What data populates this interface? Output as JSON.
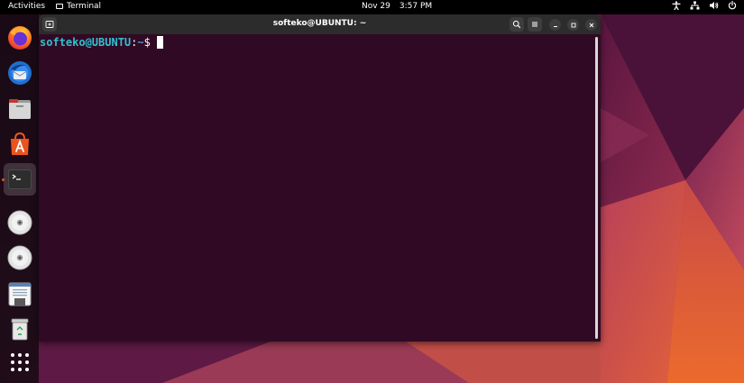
{
  "topbar": {
    "activities": "Activities",
    "app_name": "Terminal",
    "date": "Nov 29",
    "time": "3:57 PM",
    "icons": [
      "accessibility-icon",
      "network-icon",
      "volume-icon",
      "power-icon"
    ]
  },
  "dock": {
    "items": [
      {
        "name": "firefox",
        "icon": "firefox-icon"
      },
      {
        "name": "thunderbird",
        "icon": "thunderbird-icon"
      },
      {
        "name": "files",
        "icon": "files-icon"
      },
      {
        "name": "app-center",
        "icon": "app-center-icon"
      },
      {
        "name": "terminal",
        "icon": "terminal-icon",
        "active": true
      },
      {
        "name": "disc-1",
        "icon": "cd-icon"
      },
      {
        "name": "disc-2",
        "icon": "cd-icon"
      },
      {
        "name": "text-editor",
        "icon": "notes-icon"
      },
      {
        "name": "trash",
        "icon": "trash-icon"
      },
      {
        "name": "show-apps",
        "icon": "app-grid-icon"
      }
    ]
  },
  "window": {
    "title": "softeko@UBUNTU: ~",
    "prompt_user": "softeko@UBUNTU",
    "prompt_colon": ":",
    "prompt_path": "~",
    "prompt_symbol": "$",
    "background_color": "#300a24"
  },
  "colors": {
    "ubuntu_orange": "#e95420",
    "terminal_bg": "#300a24",
    "prompt_user": "#33c0d0",
    "prompt_path": "#5a8fd8"
  }
}
